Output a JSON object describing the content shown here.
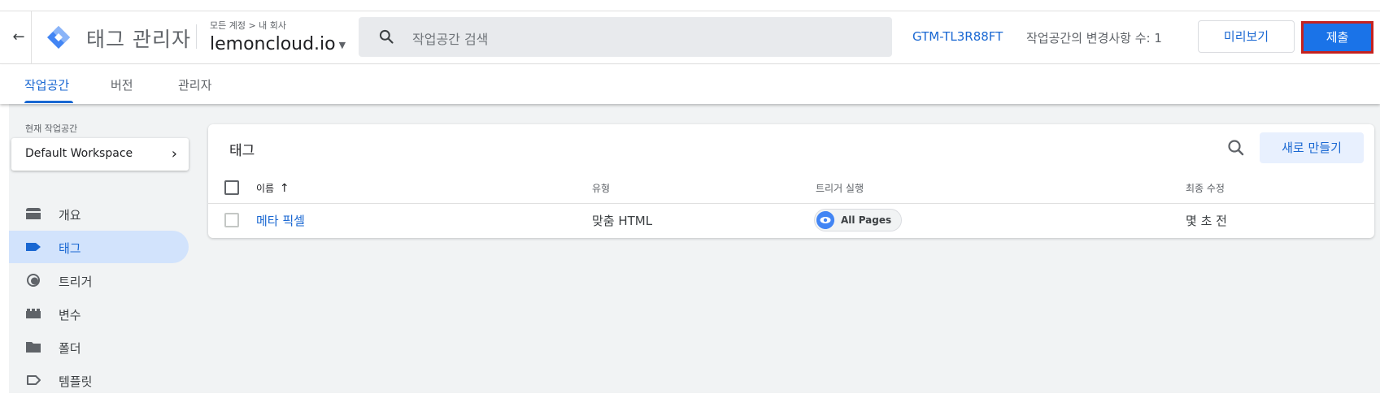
{
  "header": {
    "app_title": "태그 관리자",
    "breadcrumb": "모든 계정 > 내 회사",
    "container_name": "lemoncloud.io",
    "search_placeholder": "작업공간 검색",
    "container_id": "GTM-TL3R88FT",
    "changes_text": "작업공간의 변경사항 수: 1",
    "preview_label": "미리보기",
    "submit_label": "제출"
  },
  "tabs": [
    {
      "label": "작업공간",
      "active": true
    },
    {
      "label": "버전",
      "active": false
    },
    {
      "label": "관리자",
      "active": false
    }
  ],
  "sidebar": {
    "workspace_label": "현재 작업공간",
    "workspace_name": "Default Workspace",
    "items": [
      {
        "label": "개요",
        "icon": "overview-icon",
        "active": false
      },
      {
        "label": "태그",
        "icon": "tag-icon",
        "active": true
      },
      {
        "label": "트리거",
        "icon": "trigger-icon",
        "active": false
      },
      {
        "label": "변수",
        "icon": "variables-icon",
        "active": false
      },
      {
        "label": "폴더",
        "icon": "folder-icon",
        "active": false
      },
      {
        "label": "템플릿",
        "icon": "template-icon",
        "active": false
      }
    ]
  },
  "tags_panel": {
    "title": "태그",
    "new_button": "새로 만들기",
    "columns": [
      "이름",
      "유형",
      "트리거 실행",
      "최종 수정"
    ],
    "sort_arrow": "↑",
    "rows": [
      {
        "name": "메타 픽셀",
        "type": "맞춤 HTML",
        "trigger": "All Pages",
        "modified": "몇 초 전"
      }
    ]
  },
  "colors": {
    "accent": "#1967d2",
    "submit_bg": "#1a73e8",
    "submit_border": "#c5221f",
    "active_nav_bg": "#d2e3fc",
    "main_bg": "#f1f3f4"
  }
}
